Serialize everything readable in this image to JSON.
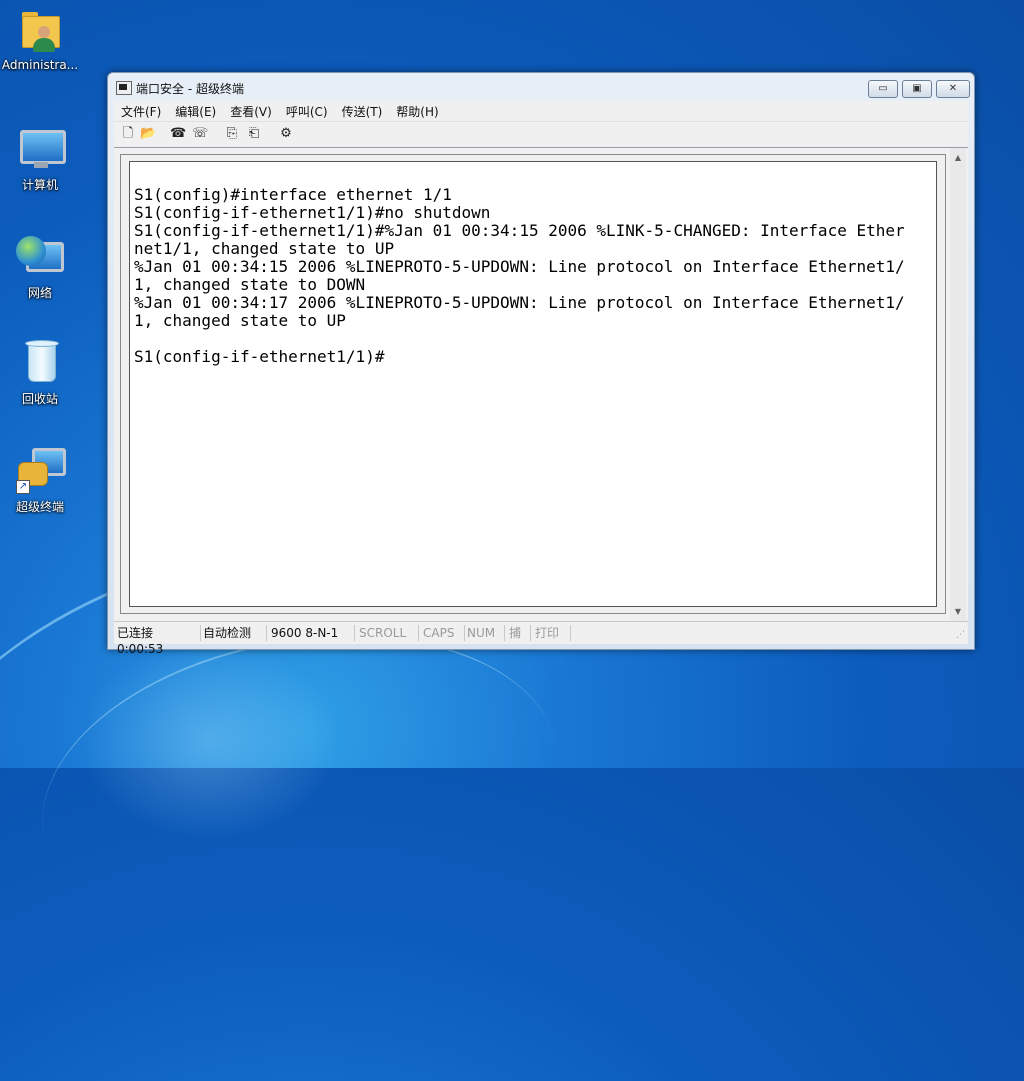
{
  "desktop": {
    "icons": [
      {
        "label": "Administra...",
        "icon": "user-folder-icon"
      },
      {
        "label": "计算机",
        "icon": "computer-icon"
      },
      {
        "label": "网络",
        "icon": "network-icon"
      },
      {
        "label": "回收站",
        "icon": "recycle-bin-icon"
      },
      {
        "label": "超级终端",
        "icon": "hyperterminal-shortcut-icon"
      }
    ]
  },
  "window": {
    "title": "端口安全 - 超级终端",
    "controls": {
      "minimize": "▭",
      "maximize": "▣",
      "close": "✕"
    },
    "menu": [
      "文件(F)",
      "编辑(E)",
      "查看(V)",
      "呼叫(C)",
      "传送(T)",
      "帮助(H)"
    ],
    "toolbar": [
      {
        "name": "new-icon",
        "glyph": "🗋"
      },
      {
        "name": "open-icon",
        "glyph": "📂"
      },
      {
        "name": "connect-icon",
        "glyph": "☎"
      },
      {
        "name": "disconnect-icon",
        "glyph": "☏"
      },
      {
        "name": "send-icon",
        "glyph": "⎘"
      },
      {
        "name": "receive-icon",
        "glyph": "⎗"
      },
      {
        "name": "properties-icon",
        "glyph": "⚙"
      }
    ],
    "terminal_lines": [
      "S1(config)#interface ethernet 1/1",
      "S1(config-if-ethernet1/1)#no shutdown",
      "S1(config-if-ethernet1/1)#%Jan 01 00:34:15 2006 %LINK-5-CHANGED: Interface Ether",
      "net1/1, changed state to UP",
      "%Jan 01 00:34:15 2006 %LINEPROTO-5-UPDOWN: Line protocol on Interface Ethernet1/",
      "1, changed state to DOWN",
      "%Jan 01 00:34:17 2006 %LINEPROTO-5-UPDOWN: Line protocol on Interface Ethernet1/",
      "1, changed state to UP",
      "",
      "S1(config-if-ethernet1/1)#"
    ],
    "status": {
      "connected": "已连接 0:00:53",
      "detect": "自动检测",
      "port": "9600 8-N-1",
      "scroll": "SCROLL",
      "caps": "CAPS",
      "num": "NUM",
      "capture": "捕",
      "print": "打印"
    }
  }
}
